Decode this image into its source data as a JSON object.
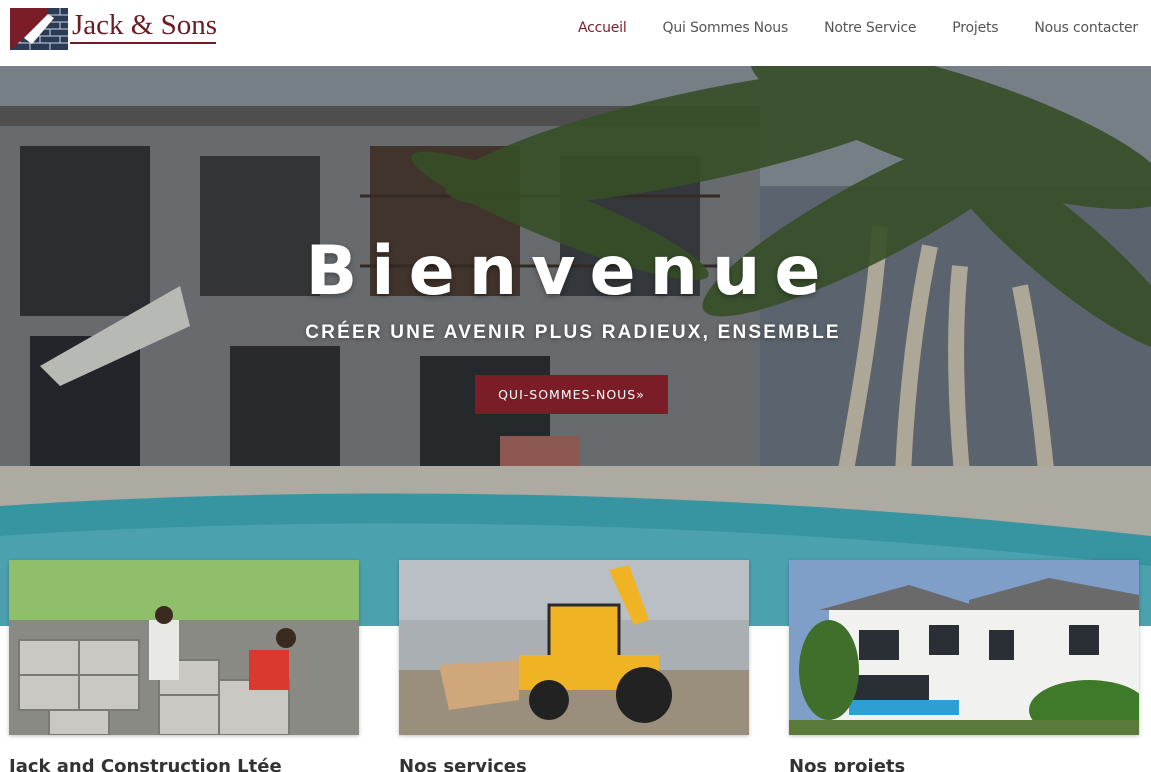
{
  "header": {
    "logo_text": "Jack & Sons",
    "nav": [
      {
        "label": "Accueil",
        "active": true
      },
      {
        "label": "Qui Sommes Nous",
        "active": false
      },
      {
        "label": "Notre Service",
        "active": false
      },
      {
        "label": "Projets",
        "active": false
      },
      {
        "label": "Nous contacter",
        "active": false
      }
    ]
  },
  "hero": {
    "title": "Bienvenue",
    "subtitle": "CRÉER UNE AVENIR PLUS RADIEUX, ENSEMBLE",
    "button_label": "QUI-SOMMES-NOUS»"
  },
  "cards": [
    {
      "title": "Jack and Construction Ltée"
    },
    {
      "title": "Nos services"
    },
    {
      "title": "Nos projets"
    }
  ],
  "colors": {
    "brand": "#7a1d26",
    "nav_text": "#555555",
    "pool": "#3fb0c0"
  }
}
